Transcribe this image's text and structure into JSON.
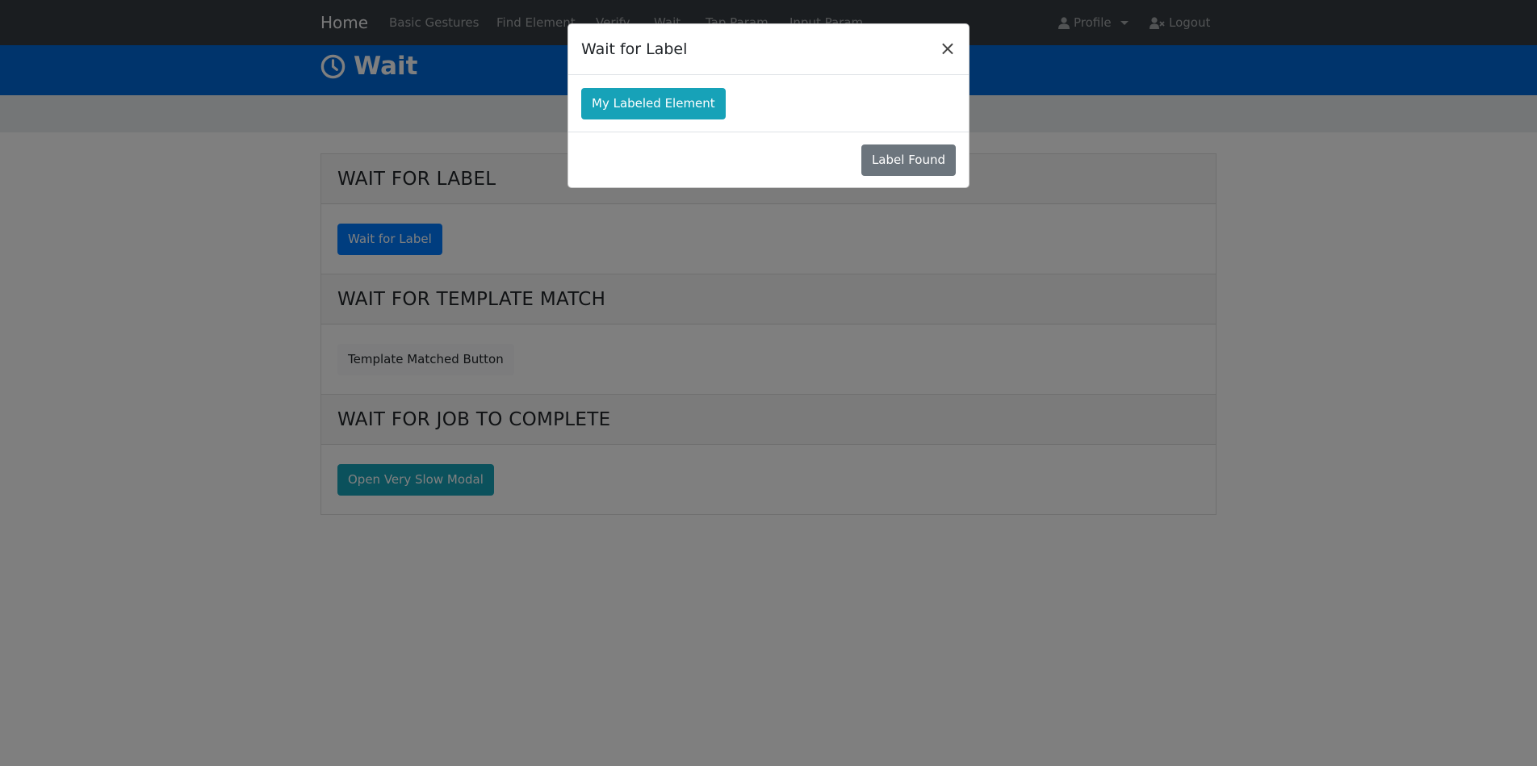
{
  "navbar": {
    "brand": "Home",
    "links": [
      "Basic Gestures",
      "Find Element",
      "Verify",
      "Wait",
      "Tap Param",
      "Input Param"
    ],
    "profile_label": "Profile",
    "logout_label": "Logout"
  },
  "header": {
    "title": "Wait"
  },
  "cards": [
    {
      "title": "WAIT FOR LABEL",
      "button": "Wait for Label"
    },
    {
      "title": "WAIT FOR TEMPLATE MATCH",
      "button": "Template Matched Button"
    },
    {
      "title": "WAIT FOR JOB TO COMPLETE",
      "button": "Open Very Slow Modal"
    }
  ],
  "modal": {
    "title": "Wait for Label",
    "close_symbol": "×",
    "body_button": "My Labeled Element",
    "footer_button": "Label Found"
  },
  "colors": {
    "navbar": "#343a40",
    "header_band": "#0069d9",
    "primary": "#007bff",
    "info": "#17a2b8",
    "secondary": "#6c757d"
  }
}
